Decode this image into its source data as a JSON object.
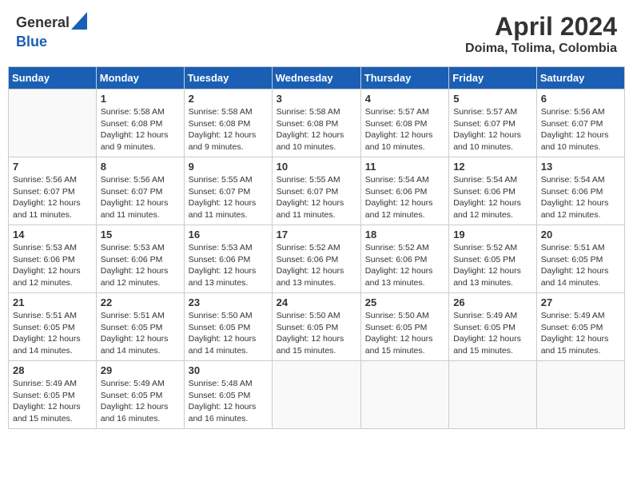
{
  "header": {
    "logo_general": "General",
    "logo_blue": "Blue",
    "month_year": "April 2024",
    "location": "Doima, Tolima, Colombia"
  },
  "calendar": {
    "days_of_week": [
      "Sunday",
      "Monday",
      "Tuesday",
      "Wednesday",
      "Thursday",
      "Friday",
      "Saturday"
    ],
    "weeks": [
      [
        {
          "day": "",
          "info": ""
        },
        {
          "day": "1",
          "info": "Sunrise: 5:58 AM\nSunset: 6:08 PM\nDaylight: 12 hours\nand 9 minutes."
        },
        {
          "day": "2",
          "info": "Sunrise: 5:58 AM\nSunset: 6:08 PM\nDaylight: 12 hours\nand 9 minutes."
        },
        {
          "day": "3",
          "info": "Sunrise: 5:58 AM\nSunset: 6:08 PM\nDaylight: 12 hours\nand 10 minutes."
        },
        {
          "day": "4",
          "info": "Sunrise: 5:57 AM\nSunset: 6:08 PM\nDaylight: 12 hours\nand 10 minutes."
        },
        {
          "day": "5",
          "info": "Sunrise: 5:57 AM\nSunset: 6:07 PM\nDaylight: 12 hours\nand 10 minutes."
        },
        {
          "day": "6",
          "info": "Sunrise: 5:56 AM\nSunset: 6:07 PM\nDaylight: 12 hours\nand 10 minutes."
        }
      ],
      [
        {
          "day": "7",
          "info": "Sunrise: 5:56 AM\nSunset: 6:07 PM\nDaylight: 12 hours\nand 11 minutes."
        },
        {
          "day": "8",
          "info": "Sunrise: 5:56 AM\nSunset: 6:07 PM\nDaylight: 12 hours\nand 11 minutes."
        },
        {
          "day": "9",
          "info": "Sunrise: 5:55 AM\nSunset: 6:07 PM\nDaylight: 12 hours\nand 11 minutes."
        },
        {
          "day": "10",
          "info": "Sunrise: 5:55 AM\nSunset: 6:07 PM\nDaylight: 12 hours\nand 11 minutes."
        },
        {
          "day": "11",
          "info": "Sunrise: 5:54 AM\nSunset: 6:06 PM\nDaylight: 12 hours\nand 12 minutes."
        },
        {
          "day": "12",
          "info": "Sunrise: 5:54 AM\nSunset: 6:06 PM\nDaylight: 12 hours\nand 12 minutes."
        },
        {
          "day": "13",
          "info": "Sunrise: 5:54 AM\nSunset: 6:06 PM\nDaylight: 12 hours\nand 12 minutes."
        }
      ],
      [
        {
          "day": "14",
          "info": "Sunrise: 5:53 AM\nSunset: 6:06 PM\nDaylight: 12 hours\nand 12 minutes."
        },
        {
          "day": "15",
          "info": "Sunrise: 5:53 AM\nSunset: 6:06 PM\nDaylight: 12 hours\nand 12 minutes."
        },
        {
          "day": "16",
          "info": "Sunrise: 5:53 AM\nSunset: 6:06 PM\nDaylight: 12 hours\nand 13 minutes."
        },
        {
          "day": "17",
          "info": "Sunrise: 5:52 AM\nSunset: 6:06 PM\nDaylight: 12 hours\nand 13 minutes."
        },
        {
          "day": "18",
          "info": "Sunrise: 5:52 AM\nSunset: 6:06 PM\nDaylight: 12 hours\nand 13 minutes."
        },
        {
          "day": "19",
          "info": "Sunrise: 5:52 AM\nSunset: 6:05 PM\nDaylight: 12 hours\nand 13 minutes."
        },
        {
          "day": "20",
          "info": "Sunrise: 5:51 AM\nSunset: 6:05 PM\nDaylight: 12 hours\nand 14 minutes."
        }
      ],
      [
        {
          "day": "21",
          "info": "Sunrise: 5:51 AM\nSunset: 6:05 PM\nDaylight: 12 hours\nand 14 minutes."
        },
        {
          "day": "22",
          "info": "Sunrise: 5:51 AM\nSunset: 6:05 PM\nDaylight: 12 hours\nand 14 minutes."
        },
        {
          "day": "23",
          "info": "Sunrise: 5:50 AM\nSunset: 6:05 PM\nDaylight: 12 hours\nand 14 minutes."
        },
        {
          "day": "24",
          "info": "Sunrise: 5:50 AM\nSunset: 6:05 PM\nDaylight: 12 hours\nand 15 minutes."
        },
        {
          "day": "25",
          "info": "Sunrise: 5:50 AM\nSunset: 6:05 PM\nDaylight: 12 hours\nand 15 minutes."
        },
        {
          "day": "26",
          "info": "Sunrise: 5:49 AM\nSunset: 6:05 PM\nDaylight: 12 hours\nand 15 minutes."
        },
        {
          "day": "27",
          "info": "Sunrise: 5:49 AM\nSunset: 6:05 PM\nDaylight: 12 hours\nand 15 minutes."
        }
      ],
      [
        {
          "day": "28",
          "info": "Sunrise: 5:49 AM\nSunset: 6:05 PM\nDaylight: 12 hours\nand 15 minutes."
        },
        {
          "day": "29",
          "info": "Sunrise: 5:49 AM\nSunset: 6:05 PM\nDaylight: 12 hours\nand 16 minutes."
        },
        {
          "day": "30",
          "info": "Sunrise: 5:48 AM\nSunset: 6:05 PM\nDaylight: 12 hours\nand 16 minutes."
        },
        {
          "day": "",
          "info": ""
        },
        {
          "day": "",
          "info": ""
        },
        {
          "day": "",
          "info": ""
        },
        {
          "day": "",
          "info": ""
        }
      ]
    ]
  }
}
